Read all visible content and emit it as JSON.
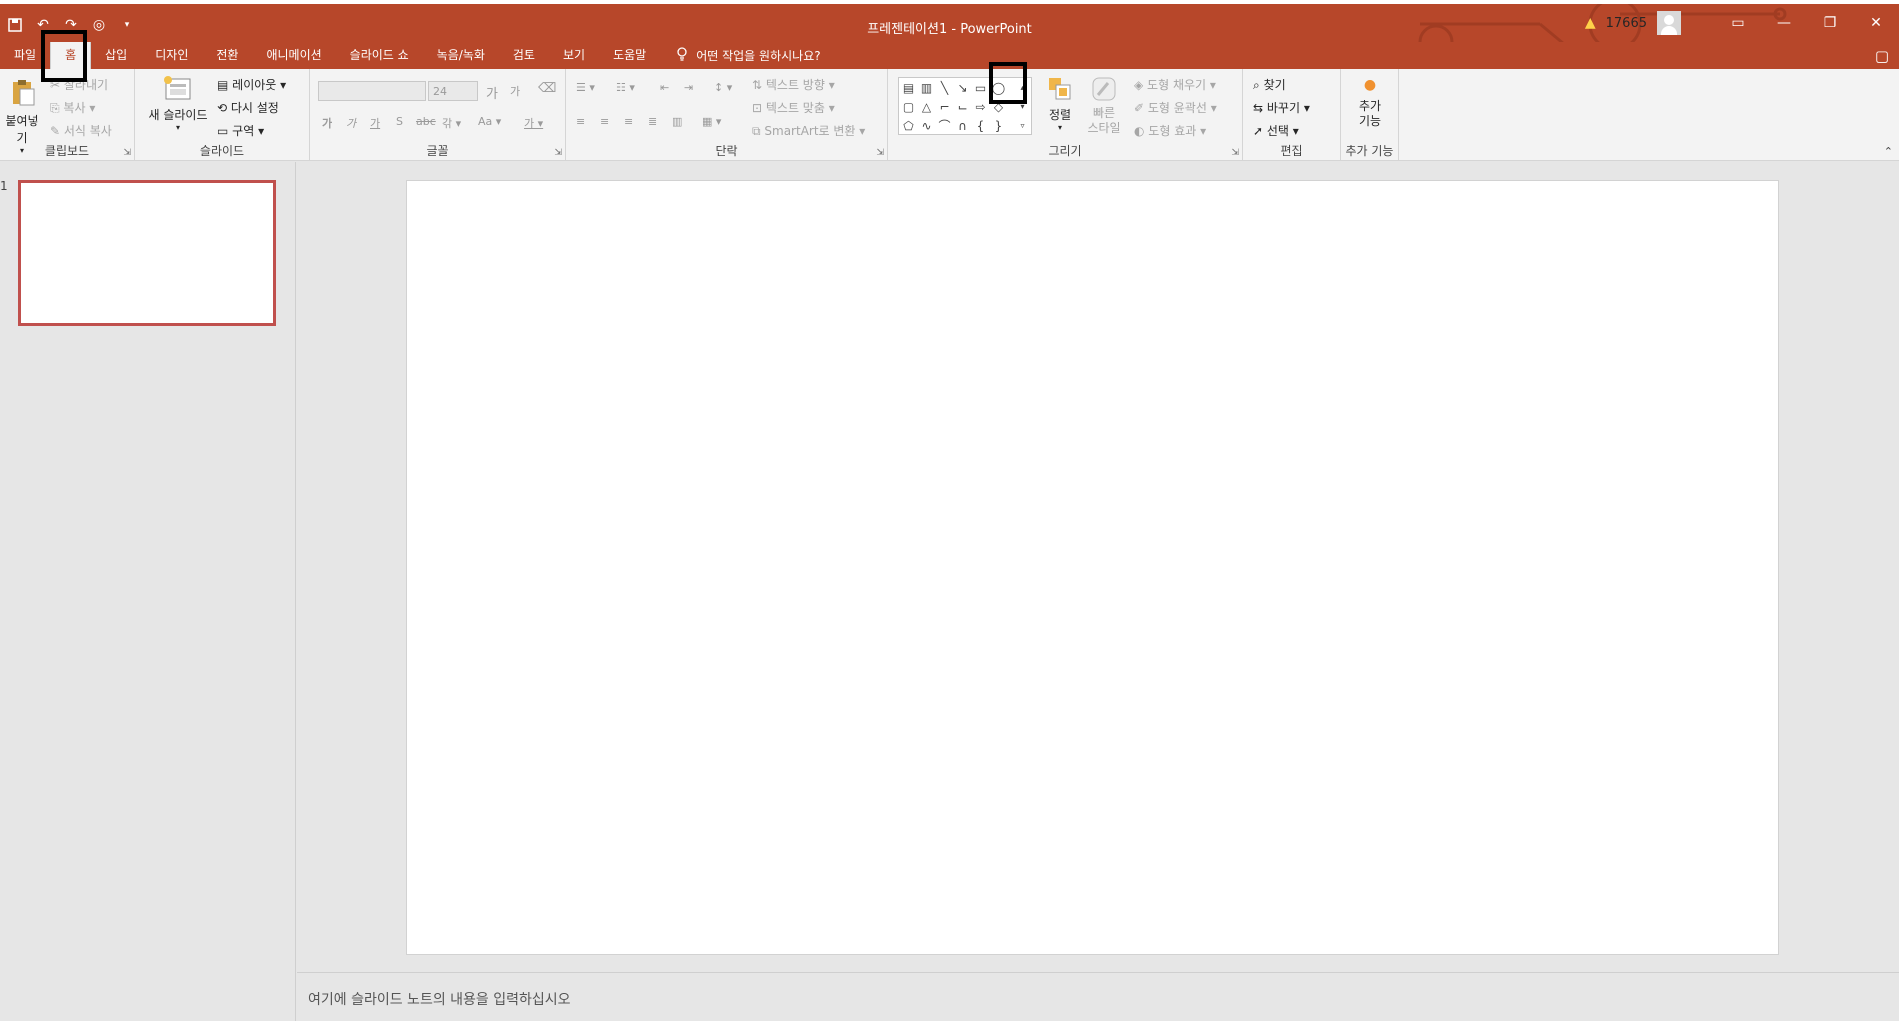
{
  "app": {
    "title": "프레젠테이션1  -  PowerPoint",
    "user_id": "17665",
    "accent_color": "#b7472a"
  },
  "qat": {
    "icons": [
      "save-icon",
      "undo-icon",
      "redo-icon",
      "presentation-icon",
      "customize-icon"
    ]
  },
  "tabs": [
    "파일",
    "홈",
    "삽입",
    "디자인",
    "전환",
    "애니메이션",
    "슬라이드 쇼",
    "녹음/녹화",
    "검토",
    "보기",
    "도움말"
  ],
  "active_tab": "홈",
  "tell_me": "어떤 작업을 원하시나요?",
  "ribbon": {
    "clipboard": {
      "paste": "붙여넣기",
      "cut": "잘라내기",
      "copy": "복사",
      "format_painter": "서식 복사",
      "label": "클립보드"
    },
    "slides": {
      "new_slide": "새 슬라이드",
      "layout": "레이아웃",
      "reset": "다시 설정",
      "section": "구역",
      "label": "슬라이드"
    },
    "font": {
      "font_size": "24",
      "label": "글꼴"
    },
    "paragraph": {
      "text_direction": "텍스트 방향",
      "align_text": "텍스트 맞춤",
      "smartart": "SmartArt로 변환",
      "label": "단락"
    },
    "drawing": {
      "arrange": "정렬",
      "quick_styles": "빠른 스타일",
      "shape_fill": "도형 채우기",
      "shape_outline": "도형 윤곽선",
      "shape_effects": "도형 효과",
      "label": "그리기"
    },
    "editing": {
      "find": "찾기",
      "replace": "바꾸기",
      "select": "선택",
      "label": "편집"
    },
    "addins": {
      "button": "추가 기능",
      "label": "추가 기능"
    }
  },
  "thumbnails": {
    "slide_number": "1"
  },
  "notes": {
    "placeholder": "여기에 슬라이드 노트의 내용을 입력하십시오"
  }
}
